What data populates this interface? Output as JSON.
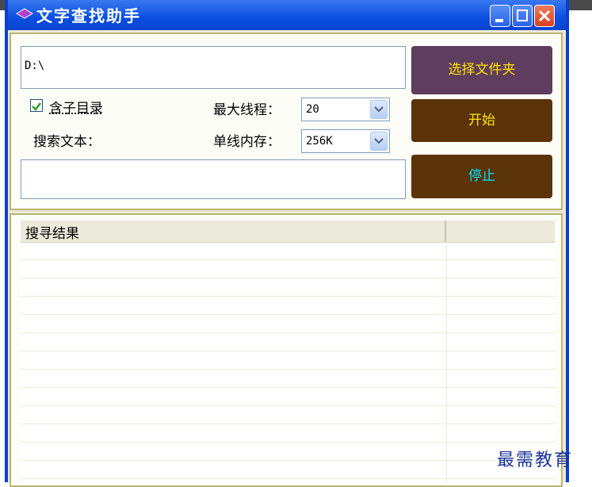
{
  "window": {
    "title": "文字查找助手"
  },
  "path": {
    "value": "D:\\"
  },
  "buttons": {
    "choose_folder": "选择文件夹",
    "start": "开始",
    "stop": "停止"
  },
  "options": {
    "include_subdirs_label": "含子目录",
    "include_subdirs_checked": true,
    "search_text_label": "搜索文本：",
    "max_threads_label": "最大线程：",
    "max_threads_value": "20",
    "thread_memory_label": "单线内存：",
    "thread_memory_value": "256K"
  },
  "search_text": {
    "value": ""
  },
  "results": {
    "column_header": "搜寻结果",
    "column2_header": "",
    "rows": []
  },
  "watermark": "最需教育",
  "colors": {
    "choose_bg": "#5e3d5e",
    "start_bg": "#5a3309",
    "stop_bg": "#5a3309",
    "choose_text": "#ffe100",
    "stop_text": "#00e5ff",
    "title_bar": "#0a4ee0"
  }
}
